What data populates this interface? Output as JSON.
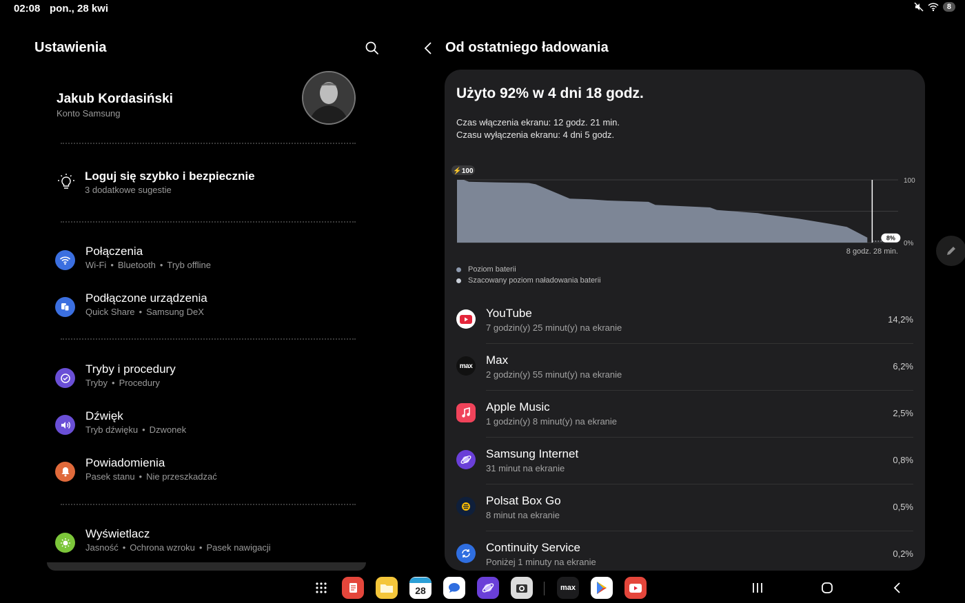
{
  "status_bar": {
    "time": "02:08",
    "date": "pon., 28 kwi",
    "notification_count": "8",
    "icons": [
      "mute-icon",
      "wifi-icon"
    ]
  },
  "left": {
    "title": "Ustawienia",
    "profile": {
      "name": "Jakub Kordasiński",
      "subtitle": "Konto Samsung"
    },
    "suggestion": {
      "title": "Loguj się szybko i bezpiecznie",
      "subtitle": "3 dodatkowe sugestie"
    },
    "menu": [
      {
        "title": "Połączenia",
        "sub": [
          "Wi-Fi",
          "Bluetooth",
          "Tryb offline"
        ],
        "color": "#3b6fe0",
        "icon": "wifi-icon"
      },
      {
        "title": "Podłączone urządzenia",
        "sub": [
          "Quick Share",
          "Samsung DeX"
        ],
        "color": "#3b6fe0",
        "icon": "devices-icon"
      },
      {
        "title": "Tryby i procedury",
        "sub": [
          "Tryby",
          "Procedury"
        ],
        "color": "#6a4fd6",
        "icon": "check-circle-icon"
      },
      {
        "title": "Dźwięk",
        "sub": [
          "Tryb dźwięku",
          "Dzwonek"
        ],
        "color": "#6a4fd6",
        "icon": "volume-icon"
      },
      {
        "title": "Powiadomienia",
        "sub": [
          "Pasek stanu",
          "Nie przeszkadzać"
        ],
        "color": "#e06a3b",
        "icon": "bell-icon"
      },
      {
        "title": "Wyświetlacz",
        "sub": [
          "Jasność",
          "Ochrona wzroku",
          "Pasek nawigacji"
        ],
        "color": "#7cc63a",
        "icon": "sun-icon"
      }
    ]
  },
  "right": {
    "title": "Od ostatniego ładowania",
    "usage_title": "Użyto 92% w 4 dni 18 godz.",
    "screen_on": "Czas włączenia ekranu: 12 godz. 21 min.",
    "screen_off": "Czasu wyłączenia ekranu: 4 dni 5 godz.",
    "legend": [
      {
        "label": "Poziom baterii",
        "color": "#8d99ad"
      },
      {
        "label": "Szacowany poziom naładowania baterii",
        "color": "#c9ced8"
      }
    ],
    "apps": [
      {
        "name": "YouTube",
        "sub": "7 godzin(y) 25 minut(y) na ekranie",
        "pct": "14,2%",
        "icon": "youtube-icon",
        "color": "#ffffff"
      },
      {
        "name": "Max",
        "sub": "2 godzin(y) 55 minut(y) na ekranie",
        "pct": "6,2%",
        "icon": "max-icon",
        "color": "#111111"
      },
      {
        "name": "Apple Music",
        "sub": "1 godzin(y) 8 minut(y) na ekranie",
        "pct": "2,5%",
        "icon": "music-icon",
        "color": "#f0435a"
      },
      {
        "name": "Samsung Internet",
        "sub": "31 minut na ekranie",
        "pct": "0,8%",
        "icon": "planet-icon",
        "color": "#6a3fd8"
      },
      {
        "name": "Polsat Box Go",
        "sub": "8 minut na ekranie",
        "pct": "0,5%",
        "icon": "polsat-icon",
        "color": "#0f1f3a"
      },
      {
        "name": "Continuity Service",
        "sub": "Poniżej 1 minuty na ekranie",
        "pct": "0,2%",
        "icon": "sync-icon",
        "color": "#2f6ee0"
      }
    ]
  },
  "chart_data": {
    "type": "area",
    "series": [
      {
        "name": "Poziom baterii",
        "x": [
          0,
          2,
          3.5,
          11,
          21,
          23,
          33,
          39,
          44,
          56,
          58,
          74,
          76,
          88,
          90,
          93,
          100,
          109,
          114,
          120
        ],
        "values": [
          100,
          100,
          97,
          96,
          95,
          93,
          70,
          69,
          67,
          65,
          60,
          56,
          52,
          47,
          45,
          43,
          38,
          30,
          25,
          8
        ]
      }
    ],
    "xlim": [
      0,
      129
    ],
    "ylim": [
      0,
      100
    ],
    "y_tick_labels": [
      "100",
      "0%"
    ],
    "start_label": "100",
    "current_label": "8%",
    "remaining_label": "8 godz. 28 min.",
    "grid": true
  },
  "dock": {
    "apps": [
      {
        "name": "app-drawer-icon",
        "color": "transparent"
      },
      {
        "name": "notes-icon",
        "color": "#e4463b"
      },
      {
        "name": "files-icon",
        "color": "#f4c63a"
      },
      {
        "name": "calendar-icon",
        "color": "#ffffff",
        "text": "28"
      },
      {
        "name": "messages-icon",
        "color": "#ffffff"
      },
      {
        "name": "samsung-internet-icon",
        "color": "#6a3fd8"
      },
      {
        "name": "camera-icon",
        "color": "#dddddd"
      },
      {
        "name": "max-icon",
        "color": "#1c1c1e",
        "text": "max"
      },
      {
        "name": "play-store-icon",
        "color": "#ffffff"
      },
      {
        "name": "youtube-icon",
        "color": "#e4463b"
      }
    ]
  }
}
